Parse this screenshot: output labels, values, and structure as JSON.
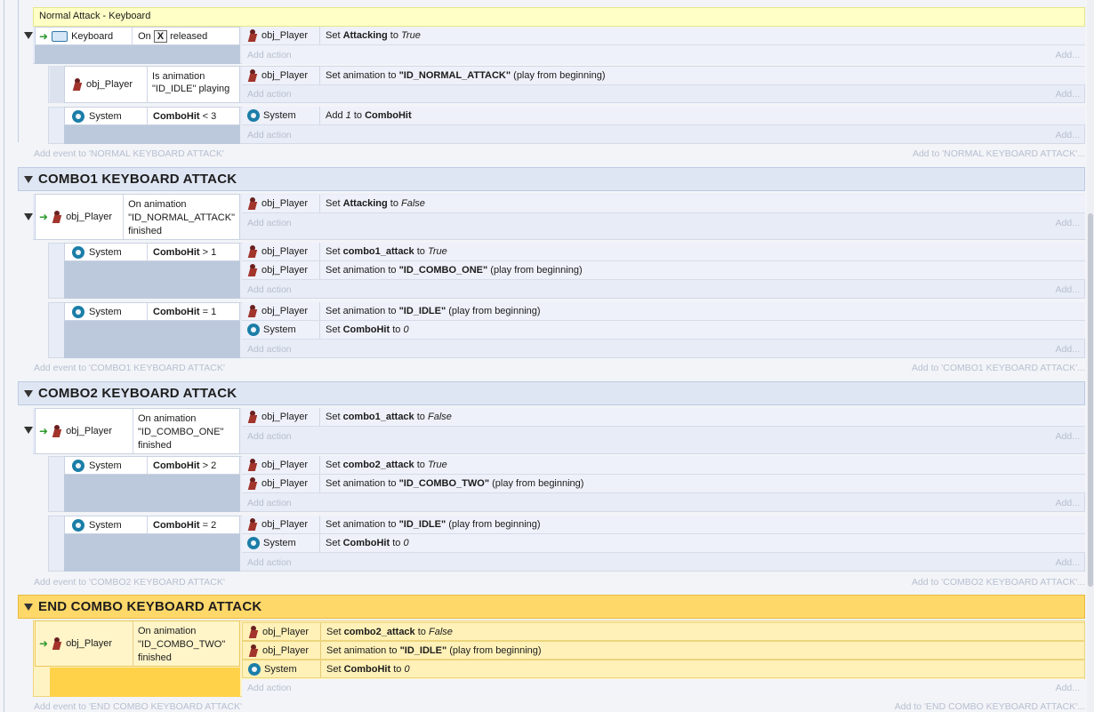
{
  "event_sheet": {
    "top_comment": "Normal Attack - Keyboard",
    "groups": [
      {
        "title": "COMBO1 KEYBOARD ATTACK",
        "add_event": "Add event to 'COMBO1 KEYBOARD ATTACK'",
        "add_event_right": "Add to 'COMBO1 KEYBOARD ATTACK'..."
      },
      {
        "title": "COMBO2 KEYBOARD ATTACK",
        "add_event": "Add event to 'COMBO2 KEYBOARD ATTACK'",
        "add_event_right": "Add to 'COMBO2 KEYBOARD ATTACK'..."
      },
      {
        "title": "END COMBO KEYBOARD ATTACK",
        "add_event": "Add event to 'END COMBO KEYBOARD ATTACK'",
        "add_event_right": "Add to 'END COMBO KEYBOARD ATTACK'..."
      }
    ],
    "normal_group": {
      "add_event": "Add event to 'NORMAL KEYBOARD ATTACK'",
      "add_event_right": "Add to 'NORMAL KEYBOARD ATTACK'..."
    },
    "labels": {
      "keyboard": "Keyboard",
      "obj_player": "obj_Player",
      "system": "System",
      "on": "On",
      "key": "X",
      "released": "released",
      "add_action": "Add action",
      "add_more": "Add...",
      "is_anim_1": "Is animation",
      "is_anim_2": "\"ID_IDLE\" playing",
      "combohit_lt3": "< 3",
      "combohit_gt1": "> 1",
      "combohit_eq1": "= 1",
      "combohit_gt2": "> 2",
      "combohit_eq2": "= 2",
      "combohit": "ComboHit",
      "on_anim": "On animation",
      "anim_normal": "\"ID_NORMAL_ATTACK\"",
      "anim_combo_one": "\"ID_COMBO_ONE\"",
      "anim_combo_two": "\"ID_COMBO_TWO\"",
      "finished": "finished",
      "set": "Set",
      "to": "to",
      "true": "True",
      "false": "False",
      "zero": "0",
      "one": "1",
      "attacking": "Attacking",
      "combo1_attack": "combo1_attack",
      "combo2_attack": "combo2_attack",
      "set_anim_to": "Set animation to",
      "play_from_beginning": "(play from beginning)",
      "add": "Add"
    }
  }
}
